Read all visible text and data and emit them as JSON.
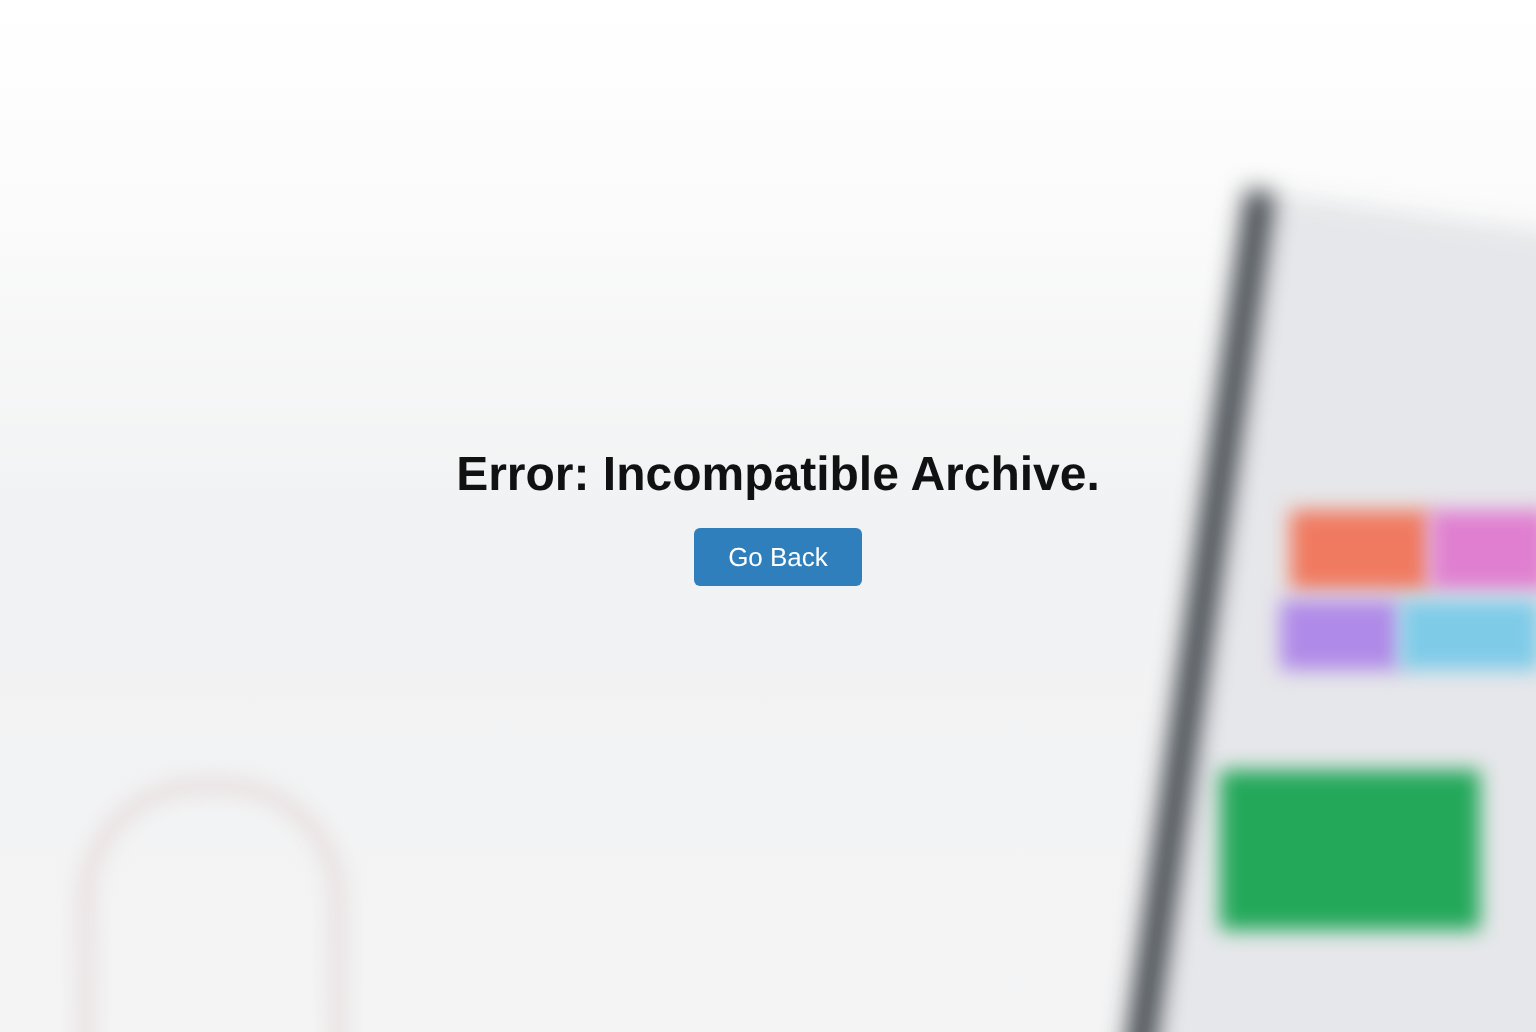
{
  "message": "Error: Incompatible Archive.",
  "button": {
    "label": "Go Back"
  }
}
